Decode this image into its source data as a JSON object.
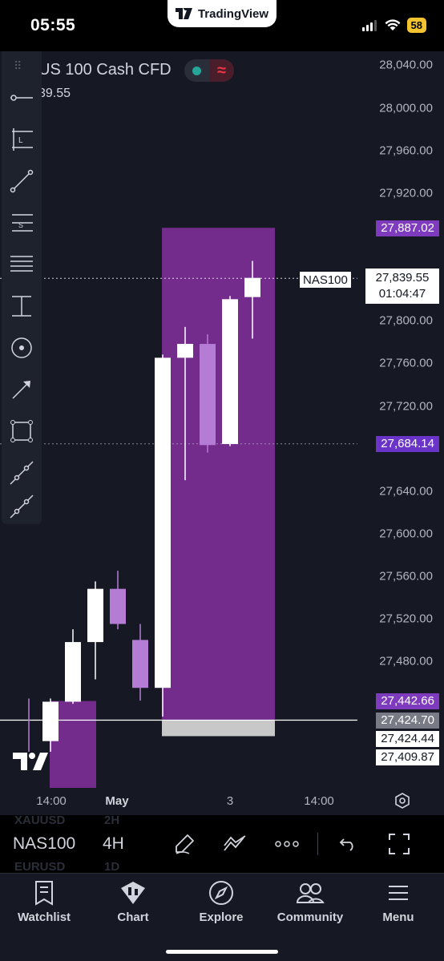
{
  "status_bar": {
    "time": "05:55",
    "brand": "TradingView",
    "battery": "58"
  },
  "chart": {
    "symbol_title": "US 100 Cash CFD",
    "symbol_sub_value": "39.55",
    "price_axis": [
      "28,040.00",
      "28,000.00",
      "27,960.00",
      "27,920.00",
      "27,800.00",
      "27,760.00",
      "27,720.00",
      "27,640.00",
      "27,600.00",
      "27,560.00",
      "27,520.00",
      "27,480.00"
    ],
    "price_tags": {
      "top_range": "27,887.02",
      "mid_range": "27,684.14",
      "bottom_range": "27,442.66",
      "gray": "27,424.70",
      "white_1": "27,424.44",
      "white_2": "27,409.87"
    },
    "last_price": {
      "symbol": "NAS100",
      "price": "27,839.55",
      "countdown": "01:04:47"
    },
    "time_axis": [
      "14:00",
      "May",
      "3",
      "14:00"
    ],
    "colors": {
      "background": "#161923",
      "candle_up": "#ffffff",
      "candle_down": "#b57cd6",
      "range_box": "#732b8c"
    }
  },
  "chart_data": {
    "type": "candlestick",
    "y_unit": "price",
    "ylim": [
      27395,
      28060
    ],
    "candles": [
      {
        "o": 27405,
        "h": 27445,
        "l": 27395,
        "c": 27442
      },
      {
        "o": 27442,
        "h": 27510,
        "l": 27440,
        "c": 27498
      },
      {
        "o": 27498,
        "h": 27555,
        "l": 27463,
        "c": 27548
      },
      {
        "o": 27548,
        "h": 27565,
        "l": 27510,
        "c": 27515
      },
      {
        "o": 27500,
        "h": 27515,
        "l": 27443,
        "c": 27455
      },
      {
        "o": 27455,
        "h": 27768,
        "l": 27428,
        "c": 27765
      },
      {
        "o": 27765,
        "h": 27794,
        "l": 27650,
        "c": 27778
      },
      {
        "o": 27778,
        "h": 27787,
        "l": 27676,
        "c": 27683
      },
      {
        "o": 27684,
        "h": 27823,
        "l": 27682,
        "c": 27820
      },
      {
        "o": 27822,
        "h": 27856,
        "l": 27783,
        "c": 27840
      }
    ],
    "range_box": {
      "top": 27887.02,
      "bottom": 27424.7,
      "mid": 27684.14
    }
  },
  "symbol_bar": {
    "symbol": "NAS100",
    "timeframe": "4H",
    "ghost_top_symbol": "XAUUSD",
    "ghost_top_tf": "2H",
    "ghost_bottom_symbol": "EURUSD",
    "ghost_bottom_tf": "1D"
  },
  "bottom_nav": {
    "items": [
      {
        "label": "Watchlist",
        "icon": "watchlist-icon"
      },
      {
        "label": "Chart",
        "icon": "chart-icon"
      },
      {
        "label": "Explore",
        "icon": "compass-icon"
      },
      {
        "label": "Community",
        "icon": "community-icon"
      },
      {
        "label": "Menu",
        "icon": "menu-icon"
      }
    ]
  }
}
